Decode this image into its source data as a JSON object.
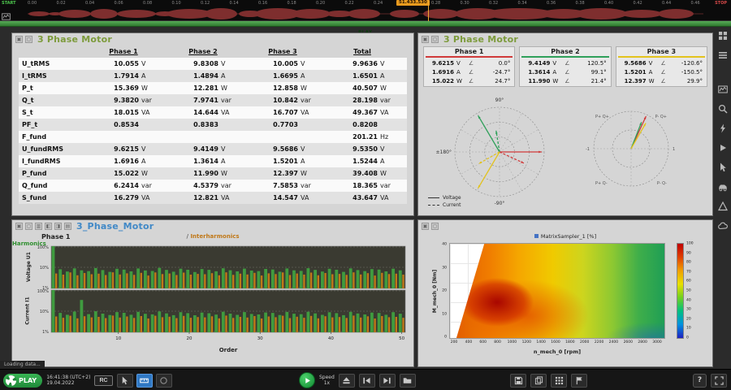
{
  "top": {
    "start": "START",
    "stop": "STOP",
    "cursor_time": "51.433.530",
    "strip_label": "PLAY",
    "ticks": [
      "0.00",
      "0.02",
      "0.04",
      "0.06",
      "0.08",
      "0.10",
      "0.12",
      "0.14",
      "0.16",
      "0.18",
      "0.20",
      "0.22",
      "0.24",
      "0.26",
      "0.28",
      "0.30",
      "0.32",
      "0.34",
      "0.36",
      "0.38",
      "0.40",
      "0.42",
      "0.44",
      "0.46"
    ]
  },
  "sidebar": {
    "icons": [
      "grid-icon",
      "list-icon",
      "scope-icon",
      "zoom-icon",
      "bolt-icon",
      "marker-icon",
      "cursor-icon",
      "car-icon",
      "delta-icon",
      "cloud-icon"
    ]
  },
  "panels": {
    "rms": {
      "title": "3 Phase Motor",
      "columns": [
        "Phase 1",
        "Phase 2",
        "Phase 3",
        "Total"
      ],
      "rows": [
        [
          "U_tRMS",
          "10.055",
          "V",
          "9.8308",
          "V",
          "10.005",
          "V",
          "9.9636",
          "V"
        ],
        [
          "I_tRMS",
          "1.7914",
          "A",
          "1.4894",
          "A",
          "1.6695",
          "A",
          "1.6501",
          "A"
        ],
        [
          "P_t",
          "15.369",
          "W",
          "12.281",
          "W",
          "12.858",
          "W",
          "40.507",
          "W"
        ],
        [
          "Q_t",
          "9.3820",
          "var",
          "7.9741",
          "var",
          "10.842",
          "var",
          "28.198",
          "var"
        ],
        [
          "S_t",
          "18.015",
          "VA",
          "14.644",
          "VA",
          "16.707",
          "VA",
          "49.367",
          "VA"
        ],
        [
          "PF_t",
          "0.8534",
          "",
          "0.8383",
          "",
          "0.7703",
          "",
          "0.8208",
          ""
        ],
        [
          "F_fund",
          "",
          "",
          "",
          "",
          "",
          "",
          "201.21",
          "Hz"
        ],
        [
          "U_fundRMS",
          "9.6215",
          "V",
          "9.4149",
          "V",
          "9.5686",
          "V",
          "9.5350",
          "V"
        ],
        [
          "I_fundRMS",
          "1.6916",
          "A",
          "1.3614",
          "A",
          "1.5201",
          "A",
          "1.5244",
          "A"
        ],
        [
          "P_fund",
          "15.022",
          "W",
          "11.990",
          "W",
          "12.397",
          "W",
          "39.408",
          "W"
        ],
        [
          "Q_fund",
          "6.2414",
          "var",
          "4.5379",
          "var",
          "7.5853",
          "var",
          "18.365",
          "var"
        ],
        [
          "S_fund",
          "16.279",
          "VA",
          "12.821",
          "VA",
          "14.547",
          "VA",
          "43.647",
          "VA"
        ]
      ]
    },
    "vector": {
      "title": "3 Phase Motor",
      "angle_symbol": "∠",
      "phases": [
        {
          "name": "Phase 1",
          "color": "#d03a3a",
          "rows": [
            {
              "v": "9.6215",
              "u": "V",
              "a": "0.0°"
            },
            {
              "v": "1.6916",
              "u": "A",
              "a": "-24.7°"
            },
            {
              "v": "15.022",
              "u": "W",
              "a": "24.7°"
            }
          ]
        },
        {
          "name": "Phase 2",
          "color": "#2fa05a",
          "rows": [
            {
              "v": "9.4149",
              "u": "V",
              "a": "120.5°"
            },
            {
              "v": "1.3614",
              "u": "A",
              "a": "99.1°"
            },
            {
              "v": "11.990",
              "u": "W",
              "a": "21.4°"
            }
          ]
        },
        {
          "name": "Phase 3",
          "color": "#e3c31e",
          "rows": [
            {
              "v": "9.5686",
              "u": "V",
              "a": "-120.6°"
            },
            {
              "v": "1.5201",
              "u": "A",
              "a": "-150.5°"
            },
            {
              "v": "12.397",
              "u": "W",
              "a": "29.9°"
            }
          ]
        }
      ],
      "polar_labels": {
        "top": "90°",
        "left": "±180°",
        "bottom": "-90°"
      },
      "quadrant_labels": [
        "P+ Q+",
        "P- Q+",
        "P+ Q-",
        "P- Q-"
      ],
      "axis_labels": {
        "right": "1",
        "left": "-1"
      },
      "legend": {
        "voltage": "Voltage",
        "current": "Current"
      }
    },
    "harmonics": {
      "title": "3_Phase_Motor",
      "phase_label": "Phase 1",
      "legend": {
        "harmonics": "Harmonics",
        "separator": "/",
        "interharmonics": "Interharmonics"
      },
      "xlabel": "Order",
      "xticks": [
        "10",
        "20",
        "30",
        "40",
        "50"
      ],
      "charts": [
        {
          "ylabel": "Voltage U1",
          "yticks": [
            "100%",
            "10%",
            "1%"
          ],
          "harmonics": [
            100,
            8.1,
            6.3,
            8.9,
            7.2,
            6.6,
            9.2,
            7.4,
            6.1,
            8.5,
            7.8,
            6.4,
            8.8,
            7.1,
            6.7,
            9.4,
            7.5,
            6.2,
            8.6,
            7.7,
            6.0,
            8.3,
            7.6,
            6.5,
            9.0,
            7.3,
            6.4,
            8.7,
            7.0,
            6.6,
            8.4,
            7.9,
            6.2,
            8.8,
            7.2,
            6.8,
            9.1,
            7.5,
            6.3,
            8.5,
            7.7,
            6.1,
            8.9,
            7.4,
            6.6,
            8.2,
            7.8,
            6.4,
            8.6,
            7.2
          ],
          "interharmonics": [
            5.1,
            4.5,
            5.7,
            4.2,
            5.4,
            4.7,
            5.0,
            4.3,
            5.8,
            4.6,
            5.2,
            4.4,
            5.5,
            4.1,
            5.7,
            4.8,
            5.1,
            4.3,
            5.6,
            4.5,
            4.9,
            4.7,
            5.3,
            4.2,
            5.8,
            4.4,
            5.0,
            4.6,
            5.5,
            4.1,
            5.2,
            4.8,
            5.7,
            4.3,
            5.1,
            4.5,
            5.6,
            4.2,
            5.4,
            4.7,
            4.9,
            4.4,
            5.8,
            4.6,
            5.3,
            4.1,
            5.5,
            4.8,
            5.0,
            4.5
          ]
        },
        {
          "ylabel": "Current I1",
          "yticks": [
            "100%",
            "10%",
            "1%"
          ],
          "harmonics": [
            100,
            8.3,
            6.8,
            9.6,
            34.0,
            7.3,
            9.9,
            7.7,
            6.6,
            9.1,
            8.4,
            6.8,
            9.3,
            7.5,
            7.1,
            9.7,
            7.9,
            6.5,
            9.0,
            8.1,
            6.4,
            8.6,
            8.0,
            6.9,
            9.4,
            7.7,
            6.7,
            9.1,
            7.4,
            7.0,
            8.7,
            8.3,
            6.6,
            9.2,
            7.6,
            7.2,
            9.4,
            7.9,
            6.7,
            8.9,
            8.1,
            6.5,
            9.3,
            7.8,
            7.0,
            8.6,
            8.2,
            6.8,
            9.0,
            7.6
          ],
          "interharmonics": [
            5.6,
            4.9,
            6.1,
            4.6,
            5.8,
            5.1,
            5.4,
            4.7,
            6.2,
            5.0,
            5.6,
            4.8,
            5.9,
            4.5,
            6.1,
            5.2,
            5.5,
            4.7,
            6.0,
            4.9,
            5.3,
            5.1,
            5.7,
            4.6,
            6.2,
            4.8,
            5.4,
            5.0,
            5.9,
            4.5,
            5.6,
            5.2,
            6.1,
            4.7,
            5.5,
            4.9,
            6.0,
            4.6,
            5.8,
            5.1,
            5.3,
            4.8,
            6.2,
            5.0,
            5.7,
            4.5,
            5.9,
            5.2,
            5.4,
            4.9
          ]
        }
      ]
    },
    "heatmap": {
      "legend": "MatrixSampler_1 [%]",
      "xlabel": "n_mech_0 [rpm]",
      "ylabel": "M_mech_0 [Nm]",
      "xticks": [
        "200",
        "400",
        "600",
        "800",
        "1000",
        "1200",
        "1400",
        "1600",
        "1800",
        "2000",
        "2200",
        "2400",
        "2600",
        "2800",
        "3000"
      ],
      "yticks": [
        "40",
        "30",
        "20",
        "10",
        "0"
      ],
      "colorbar_ticks": [
        "100",
        "90",
        "80",
        "70",
        "60",
        "50",
        "40",
        "30",
        "20",
        "10",
        "0"
      ]
    }
  },
  "bottom": {
    "loading": "Loading data...",
    "badge": {
      "label": "PLAY"
    },
    "clock": {
      "time": "16:41:38 (UTC+2)",
      "date": "19.04.2022"
    },
    "rc_label": "RC",
    "left_tools": [
      "pointer-tool-icon",
      "measure-tool-icon",
      "record-circle-icon"
    ],
    "transport": {
      "speed_label": "Speed",
      "speed_value": "1x"
    },
    "right_tools": [
      "save-icon",
      "copy-icon",
      "apps-icon",
      "flag-icon"
    ],
    "help_label": "?"
  }
}
